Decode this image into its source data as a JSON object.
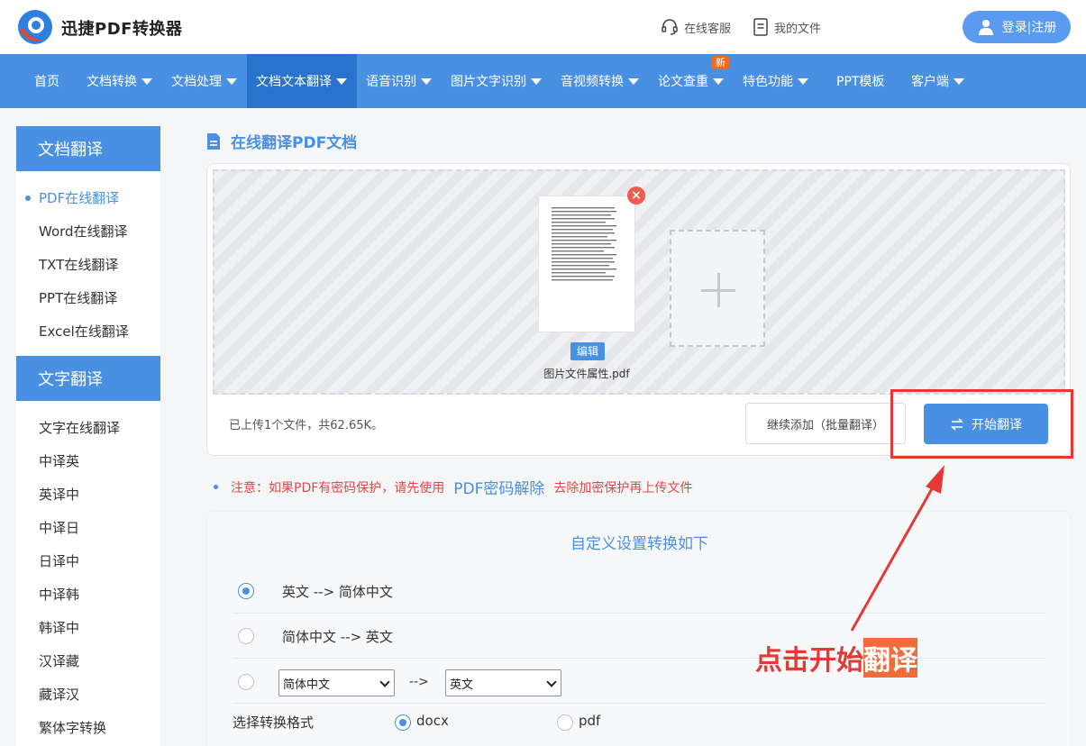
{
  "header": {
    "brand": "迅捷PDF转换器",
    "service_label": "在线客服",
    "files_label": "我的文件",
    "login_label": "登录",
    "register_label": "注册"
  },
  "nav": {
    "items": [
      {
        "label": "首页"
      },
      {
        "label": "文档转换"
      },
      {
        "label": "文档处理"
      },
      {
        "label": "文档文本翻译"
      },
      {
        "label": "语音识别"
      },
      {
        "label": "图片文字识别"
      },
      {
        "label": "音视频转换"
      },
      {
        "label": "论文查重"
      },
      {
        "label": "特色功能"
      },
      {
        "label": "PPT模板"
      },
      {
        "label": "客户端"
      }
    ],
    "new_badge": "新"
  },
  "sidebar": {
    "section1_title": "文档翻译",
    "section1_items": [
      "PDF在线翻译",
      "Word在线翻译",
      "TXT在线翻译",
      "PPT在线翻译",
      "Excel在线翻译"
    ],
    "section2_title": "文字翻译",
    "section2_items": [
      "文字在线翻译",
      "中译英",
      "英译中",
      "中译日",
      "日译中",
      "中译韩",
      "韩译中",
      "汉译藏",
      "藏译汉",
      "繁体字转换"
    ]
  },
  "main": {
    "title": "在线翻译PDF文档",
    "file_name": "图片文件属性.pdf",
    "edit_label": "编辑",
    "upload_info": "已上传1个文件，共62.65K。",
    "continue_label": "继续添加（批量翻译）",
    "start_label": "开始翻译"
  },
  "notice": {
    "prefix": "注意：如果PDF有密码保护，请先使用",
    "link": "PDF密码解除",
    "suffix": "去除加密保护再上传文件"
  },
  "settings": {
    "title": "自定义设置转换如下",
    "option1": "英文 --> 简体中文",
    "option2": "简体中文 --> 英文",
    "select_from": "简体中文",
    "arrow": "-->",
    "select_to": "英文",
    "format_label": "选择转换格式",
    "format_docx": "docx",
    "format_pdf": "pdf"
  },
  "annotation": {
    "text_plain": "点击开始",
    "text_highlight": "翻译"
  },
  "colors": {
    "primary": "#4a90e2",
    "nav_active": "#2a73cc",
    "annotation": "#e53935",
    "badge": "#f26b1d"
  }
}
